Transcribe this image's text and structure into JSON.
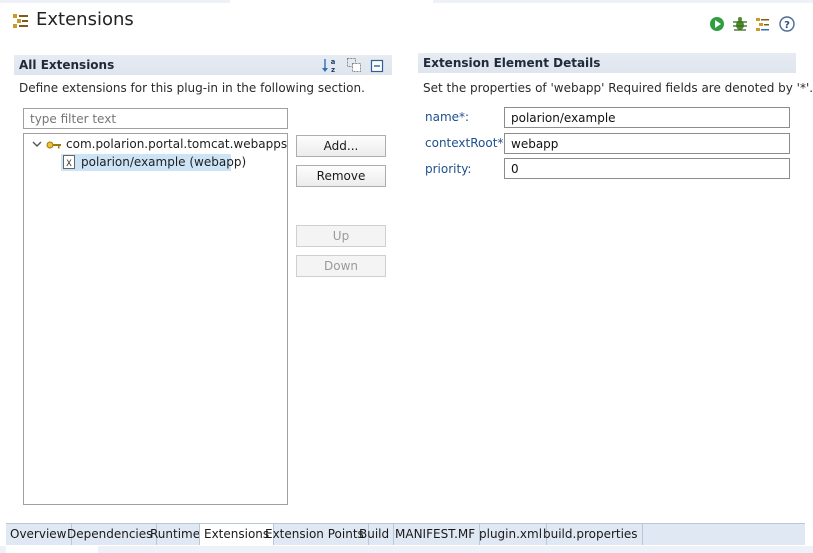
{
  "header": {
    "title": "Extensions",
    "icons": [
      "plugin-extensions-icon",
      "run-icon",
      "debug-icon",
      "extension-settings-icon",
      "help-icon"
    ]
  },
  "all_extensions": {
    "title": "All Extensions",
    "description": "Define extensions for this plug-in in the following section.",
    "filter_placeholder": "type filter text",
    "toolbar_icons": [
      "sort-alpha-icon",
      "show-extension-content-icon",
      "collapse-all-icon"
    ],
    "tree": {
      "root": {
        "label": "com.polarion.portal.tomcat.webapps",
        "expanded": true,
        "icon": "extension-point-icon"
      },
      "children": [
        {
          "label": "polarion/example (webapp)",
          "selected": true,
          "icon": "xml-element-icon"
        }
      ]
    },
    "buttons": {
      "add": "Add...",
      "remove": "Remove",
      "up": "Up",
      "down": "Down"
    }
  },
  "details": {
    "title": "Extension Element Details",
    "description": "Set the properties of 'webapp' Required fields are denoted by '*'.",
    "fields": [
      {
        "label": "name*:",
        "value": "polarion/example"
      },
      {
        "label": "contextRoot*:",
        "value": "webapp"
      },
      {
        "label": "priority:",
        "value": "0"
      }
    ]
  },
  "tabs": [
    {
      "label": "Overview"
    },
    {
      "label": "Dependencies"
    },
    {
      "label": "Runtime"
    },
    {
      "label": "Extensions",
      "active": true
    },
    {
      "label": "Extension Points"
    },
    {
      "label": "Build"
    },
    {
      "label": "MANIFEST.MF"
    },
    {
      "label": "plugin.xml"
    },
    {
      "label": "build.properties"
    }
  ],
  "colors": {
    "section_bar": "#e3e8f0",
    "label_blue": "#1f4f8f",
    "selection": "#cde4f7",
    "tab_bar": "#dfe8f3"
  }
}
